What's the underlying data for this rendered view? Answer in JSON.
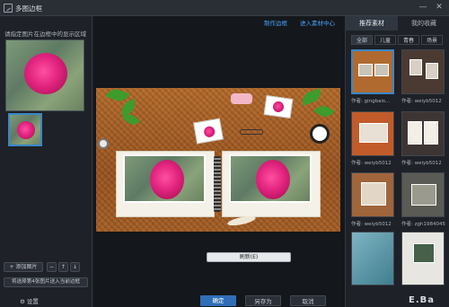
{
  "window": {
    "title": "多图边框",
    "minimize": "—",
    "close": "✕"
  },
  "left_panel": {
    "hint": "请指定图片在边框中的显示区域",
    "add_image_label": "+ 添加图片",
    "small_btn_1": "−",
    "small_btn_2": "↑",
    "small_btn_3": "↓",
    "apply_label": "将选择第4张图片送入当前边框",
    "settings_label": "设置"
  },
  "center": {
    "make_frame_link": "制作边框",
    "enter_library_link": "进入素材中心",
    "refresh_label": "刷新(E)",
    "ok_label": "确定",
    "save_as_label": "另存为",
    "cancel_label": "取消"
  },
  "right_panel": {
    "tabs": [
      "推荐素材",
      "我的收藏"
    ],
    "subtabs": [
      "全部",
      "儿童",
      "青春",
      "场景"
    ],
    "authors": [
      "作者: gingbais...",
      "作者: weiyb5012",
      "作者: weiyb5012",
      "作者: weiyb5012",
      "作者: weiyb5012",
      "作者: zgh1984045"
    ]
  },
  "watermark": "E.Ba",
  "colors": {
    "accent_blue": "#3a86c8",
    "link_blue": "#4aa3ff",
    "ok_button": "#2f6fb8",
    "wood": "#b36a2a"
  }
}
